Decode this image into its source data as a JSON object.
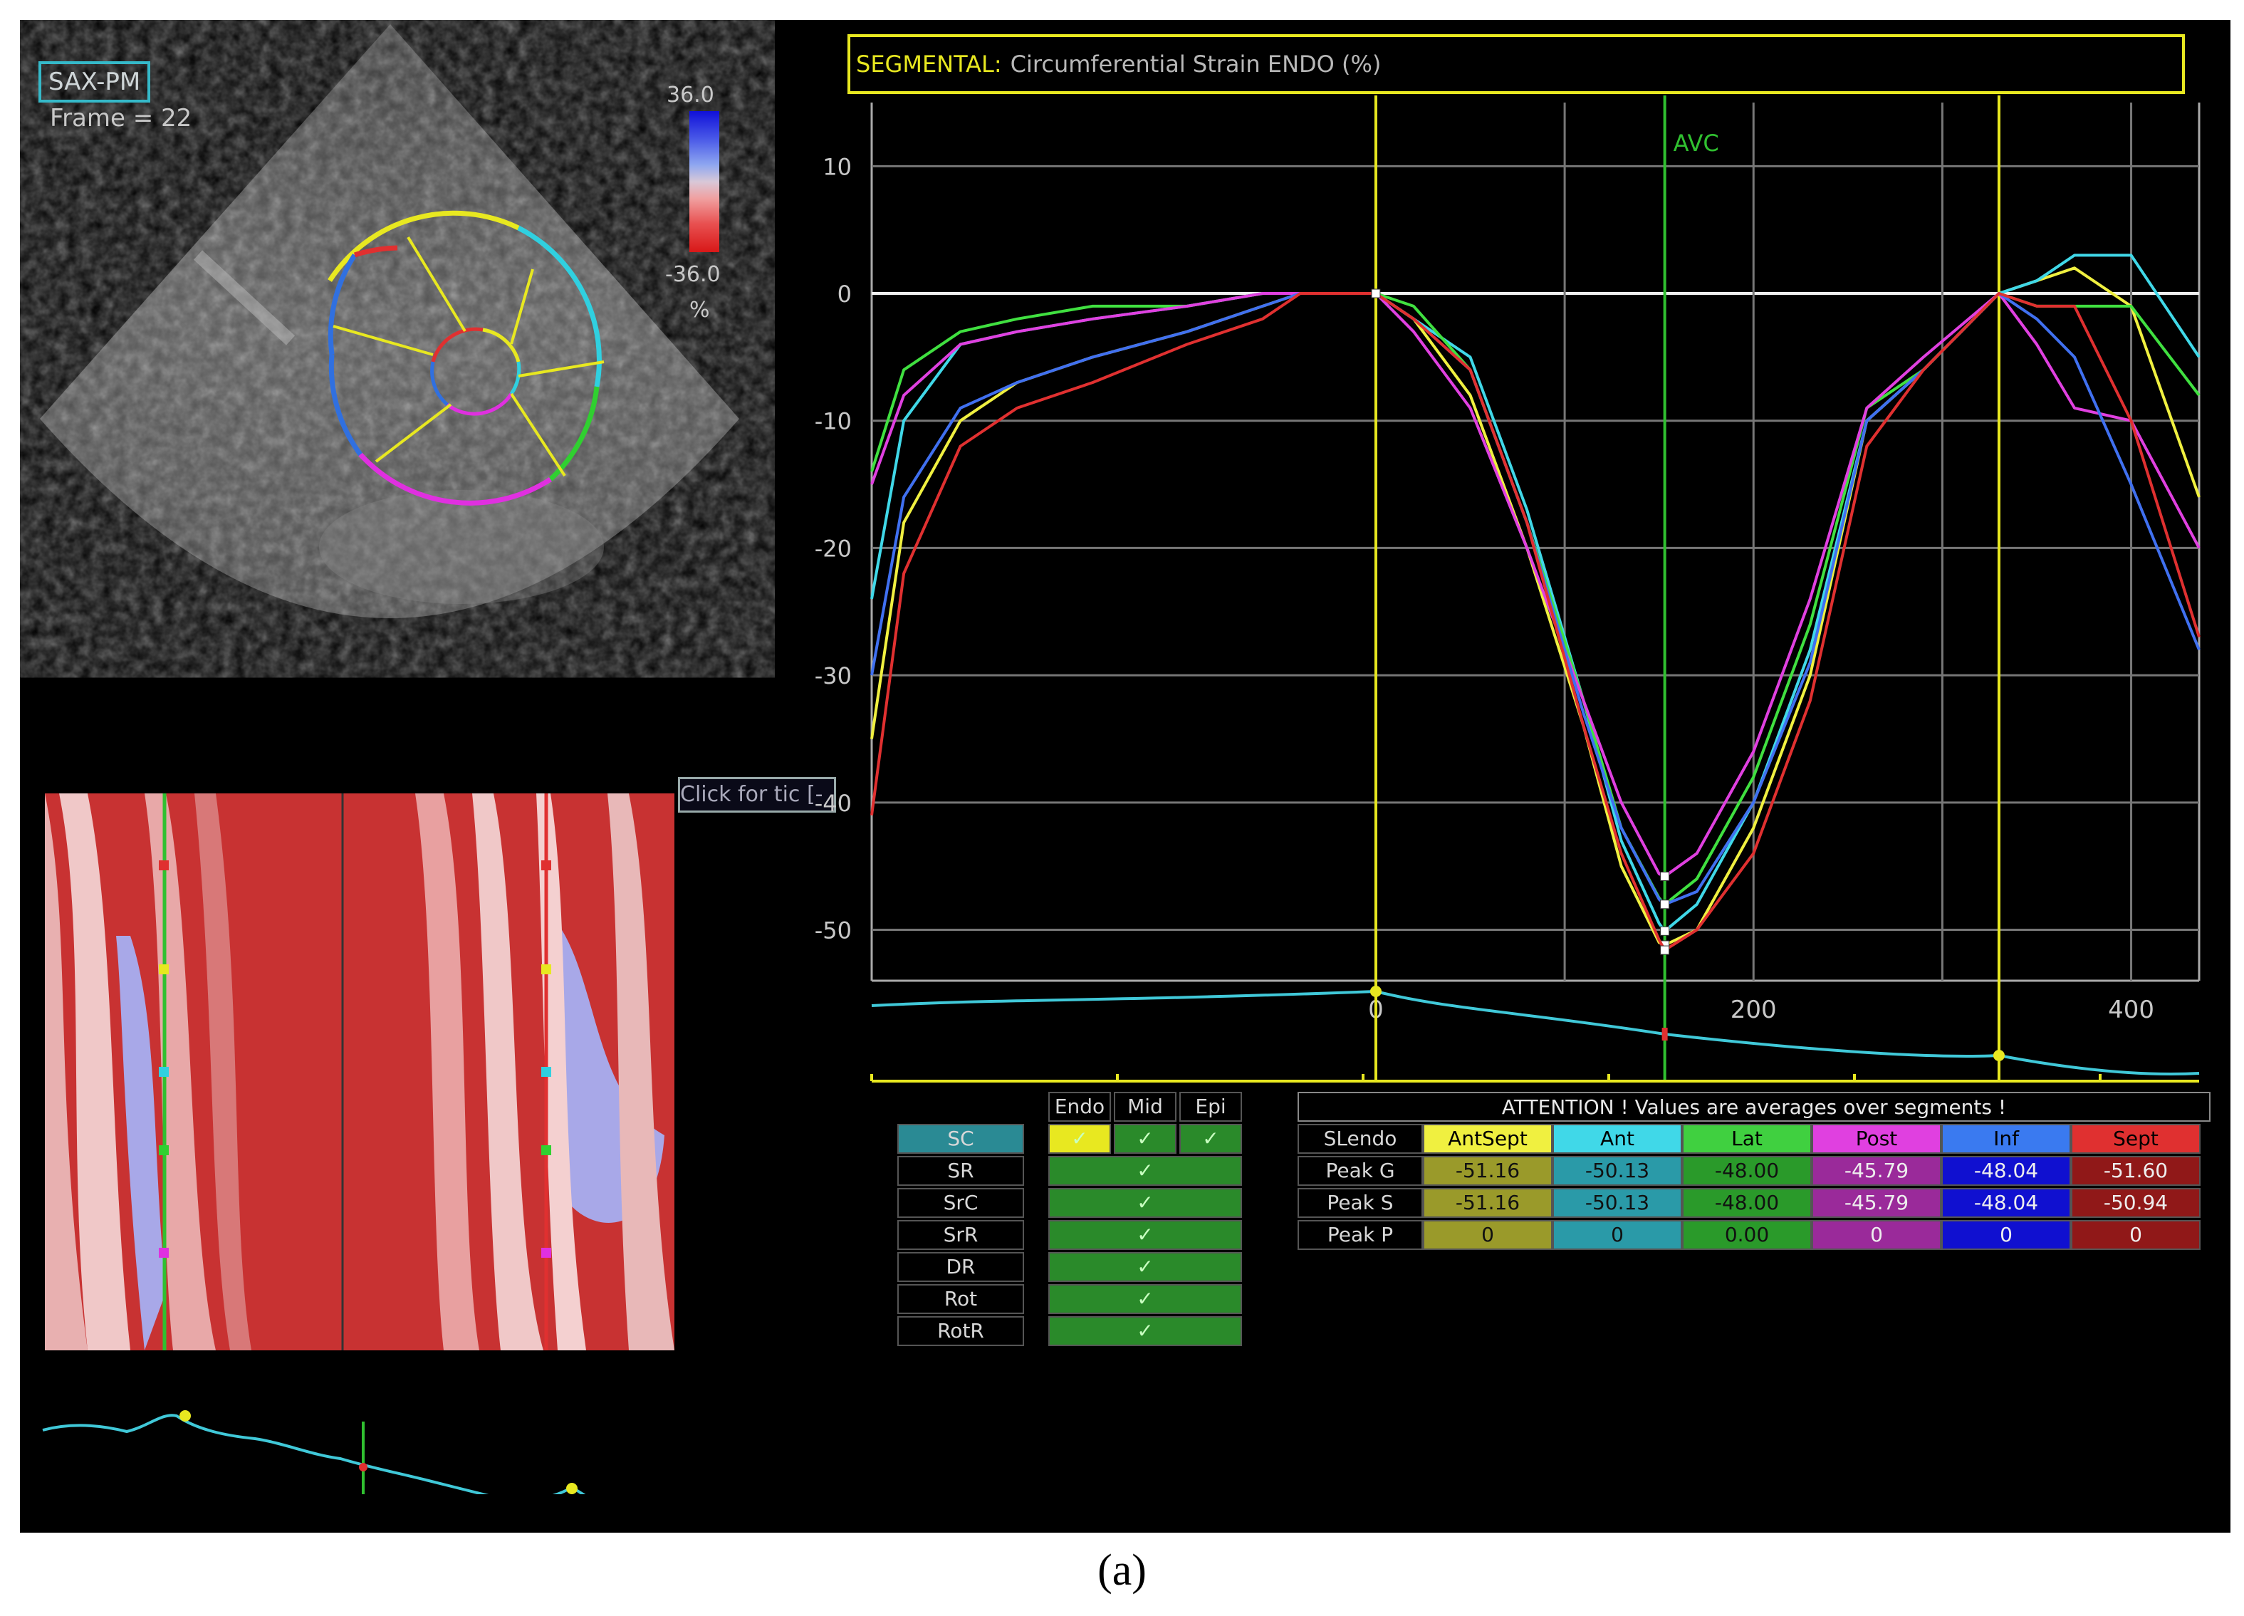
{
  "echo": {
    "view_label": "SAX-PM",
    "frame_label": "Frame = 22",
    "colorbar": {
      "max": "36.0",
      "min": "-36.0",
      "unit": "%"
    }
  },
  "mmode": {
    "button_label": "Click for tic",
    "button_suffix": "[-"
  },
  "chart_title": {
    "prefix": "SEGMENTAL:",
    "text": "Circumferential Strain ENDO (%)"
  },
  "event_labels": {
    "avc": "AVC"
  },
  "chart_data": {
    "type": "line",
    "title": "SEGMENTAL: Circumferential Strain ENDO (%)",
    "xlabel": "",
    "ylabel": "",
    "xlim": [
      -267,
      436
    ],
    "ylim": [
      -54,
      15
    ],
    "x_ticks": [
      0,
      200,
      400
    ],
    "y_ticks": [
      10,
      0,
      -10,
      -20,
      -30,
      -40,
      -50
    ],
    "y_tick_labels": [
      "10",
      "0",
      "-10",
      "-20",
      "-30",
      "-40",
      "-50"
    ],
    "grid": true,
    "event_markers": [
      {
        "label": "",
        "x": 0,
        "color": "#e8e820"
      },
      {
        "label": "AVC",
        "x": 153,
        "color": "#30c030"
      },
      {
        "label": "",
        "x": 330,
        "color": "#e8e820"
      }
    ],
    "series": [
      {
        "name": "AntSept",
        "color": "#f0f040",
        "x": [
          -267,
          -250,
          -220,
          -190,
          -150,
          -100,
          -60,
          -40,
          -20,
          0,
          20,
          50,
          80,
          110,
          130,
          150,
          153,
          170,
          200,
          230,
          260,
          290,
          330,
          350,
          370,
          400,
          436
        ],
        "y": [
          -35,
          -18,
          -10,
          -7,
          -5,
          -3,
          -1,
          0,
          0,
          0,
          -2,
          -8,
          -20,
          -34,
          -45,
          -51,
          -51.2,
          -50,
          -42,
          -30,
          -10,
          -6,
          0,
          1,
          2,
          -1,
          -16
        ]
      },
      {
        "name": "Ant",
        "color": "#40d8e8",
        "x": [
          -267,
          -250,
          -220,
          -190,
          -150,
          -100,
          -60,
          -40,
          -20,
          0,
          20,
          50,
          80,
          110,
          130,
          150,
          153,
          170,
          200,
          230,
          260,
          290,
          330,
          350,
          370,
          400,
          436
        ],
        "y": [
          -24,
          -10,
          -4,
          -3,
          -2,
          -1,
          0,
          0,
          0,
          0,
          -2,
          -5,
          -17,
          -32,
          -43,
          -49.5,
          -50.1,
          -48,
          -40,
          -28,
          -10,
          -6,
          0,
          1,
          3,
          3,
          -5
        ]
      },
      {
        "name": "Lat",
        "color": "#40e040",
        "x": [
          -267,
          -250,
          -220,
          -190,
          -150,
          -100,
          -60,
          -40,
          -20,
          0,
          20,
          50,
          80,
          110,
          130,
          150,
          153,
          170,
          200,
          230,
          260,
          290,
          330,
          350,
          370,
          400,
          436
        ],
        "y": [
          -14,
          -6,
          -3,
          -2,
          -1,
          -1,
          0,
          0,
          0,
          0,
          -1,
          -6,
          -18,
          -32,
          -42,
          -47.5,
          -48,
          -46,
          -38,
          -26,
          -9,
          -6,
          0,
          -1,
          -1,
          -1,
          -8
        ]
      },
      {
        "name": "Post",
        "color": "#e040e0",
        "x": [
          -267,
          -250,
          -220,
          -190,
          -150,
          -100,
          -60,
          -40,
          -20,
          0,
          20,
          50,
          80,
          110,
          130,
          150,
          153,
          170,
          200,
          230,
          260,
          290,
          330,
          350,
          370,
          400,
          436
        ],
        "y": [
          -15,
          -8,
          -4,
          -3,
          -2,
          -1,
          0,
          0,
          0,
          0,
          -3,
          -9,
          -20,
          -32,
          -40,
          -45.6,
          -45.8,
          -44,
          -36,
          -24,
          -9,
          -5,
          0,
          -4,
          -9,
          -10,
          -20
        ]
      },
      {
        "name": "Inf",
        "color": "#4070f0",
        "x": [
          -267,
          -250,
          -220,
          -190,
          -150,
          -100,
          -60,
          -40,
          -20,
          0,
          20,
          50,
          80,
          110,
          130,
          150,
          153,
          170,
          200,
          230,
          260,
          290,
          330,
          350,
          370,
          400,
          436
        ],
        "y": [
          -30,
          -16,
          -9,
          -7,
          -5,
          -3,
          -1,
          0,
          0,
          0,
          -2,
          -6,
          -18,
          -33,
          -42,
          -47.6,
          -48,
          -47,
          -40,
          -29,
          -10,
          -6,
          0,
          -2,
          -5,
          -15,
          -28
        ]
      },
      {
        "name": "Sept",
        "color": "#e03030",
        "x": [
          -267,
          -250,
          -220,
          -190,
          -150,
          -100,
          -60,
          -40,
          -20,
          0,
          20,
          50,
          80,
          110,
          130,
          150,
          153,
          170,
          200,
          230,
          260,
          290,
          330,
          350,
          370,
          400,
          436
        ],
        "y": [
          -41,
          -22,
          -12,
          -9,
          -7,
          -4,
          -2,
          0,
          0,
          0,
          -2,
          -6,
          -18,
          -34,
          -44,
          -50.8,
          -51.6,
          -50,
          -44,
          -32,
          -12,
          -6,
          0,
          -1,
          -1,
          -10,
          -27
        ]
      }
    ]
  },
  "sel_table": {
    "columns": [
      "Endo",
      "Mid",
      "Epi"
    ],
    "rows": [
      "SC",
      "SR",
      "SrC",
      "SrR",
      "DR",
      "Rot",
      "RotR"
    ],
    "check": "✓"
  },
  "attention": {
    "header": "ATTENTION !  Values are averages over segments !",
    "corner": "SLendo",
    "columns": [
      {
        "label": "AntSept",
        "head_bg": "#f0f040",
        "cell_bg": "#9a9a2a",
        "head_fg": "#000",
        "cell_fg": "#111"
      },
      {
        "label": "Ant",
        "head_bg": "#40d8e8",
        "cell_bg": "#2a9aa8",
        "head_fg": "#000",
        "cell_fg": "#111"
      },
      {
        "label": "Lat",
        "head_bg": "#40d040",
        "cell_bg": "#2a9a2a",
        "head_fg": "#000",
        "cell_fg": "#111"
      },
      {
        "label": "Post",
        "head_bg": "#e040e0",
        "cell_bg": "#9a2a9a",
        "head_fg": "#000",
        "cell_fg": "#eee"
      },
      {
        "label": "Inf",
        "head_bg": "#3a7af0",
        "cell_bg": "#1010d0",
        "head_fg": "#000",
        "cell_fg": "#eee"
      },
      {
        "label": "Sept",
        "head_bg": "#e03030",
        "cell_bg": "#901818",
        "head_fg": "#000",
        "cell_fg": "#eee"
      }
    ],
    "rows": [
      {
        "label": "Peak G",
        "values": [
          "-51.16",
          "-50.13",
          "-48.00",
          "-45.79",
          "-48.04",
          "-51.60"
        ]
      },
      {
        "label": "Peak S",
        "values": [
          "-51.16",
          "-50.13",
          "-48.00",
          "-45.79",
          "-48.04",
          "-50.94"
        ]
      },
      {
        "label": "Peak P",
        "values": [
          "0",
          "0",
          "0.00",
          "0",
          "0",
          "0"
        ]
      }
    ]
  },
  "caption": "(a)"
}
